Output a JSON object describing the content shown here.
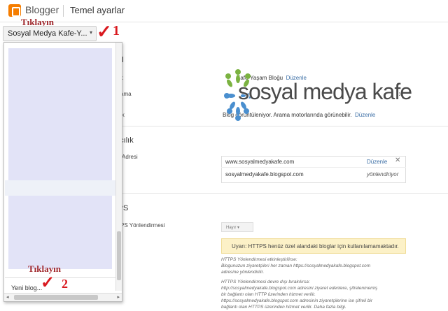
{
  "header": {
    "brand": "Blogger",
    "page_title": "Temel ayarlar"
  },
  "blog_selector": {
    "label": "Sosyal Medya Kafe-Y...",
    "caret": "▾"
  },
  "annotations": {
    "first": "Tıklayın",
    "second": "Tıklayın",
    "check": "✓",
    "num1": "1",
    "num2": "2"
  },
  "dropdown": {
    "new_blog": "Yeni blog...",
    "arrow_left": "◂",
    "arrow_right": "▸"
  },
  "sections": {
    "basic": {
      "title": "nel",
      "rows": [
        {
          "label": "k",
          "value": "Kafe-Yaşam Bloğu",
          "link": "Düzenle"
        },
        {
          "label": "ama",
          "value": "bir"
        },
        {
          "label": "ik",
          "value": "Blog görüntüleniyor. Arama motorlarında görünebilir.",
          "link": "Düzenle"
        }
      ]
    },
    "publishing": {
      "title": "ıncılık",
      "label": "Adresi",
      "domain": "www.sosyalmedyakafe.com",
      "domain_link": "Düzenle",
      "close": "✕",
      "blogspot": "sosyalmedyakafe.blogspot.com",
      "redirect": "yönlendiriyor"
    },
    "https": {
      "title": "TPS",
      "label": "PS Yönlendirmesi",
      "button": "Hayır",
      "warning": "Uyarı: HTTPS henüz özel alandaki bloglar için kullanılamamaktadır.",
      "notes": [
        "HTTPS Yönlendirmesi etkinleştirilirse:",
        "Blogunuzun ziyaretçileri her zaman https://sosyalmedyakafe.blogspot.com",
        "adresine yönlendirilir.",
        "HTTPS Yönlendirmesi devre dışı bırakılırsa:",
        "http://sosyalmedyakafe.blogspot.com adresini ziyaret edenlere, şifrelenmemiş",
        "bir bağlantı olan HTTP üzerinden hizmet verilir.",
        "https://sosyalmedyakafe.blogspot.com adresinin ziyaretçilerine ise şifreli bir",
        "bağlantı olan HTTPS üzerinden hizmet verilir. Daha fazla bilgi."
      ]
    }
  },
  "watermark": {
    "text": "sosyal medya kafe"
  },
  "colors": {
    "brand": "#f57d00",
    "annotation": "#a0282d",
    "check": "#d9191f",
    "link": "#3b6ea5",
    "warning_bg": "#fcf1c7"
  }
}
